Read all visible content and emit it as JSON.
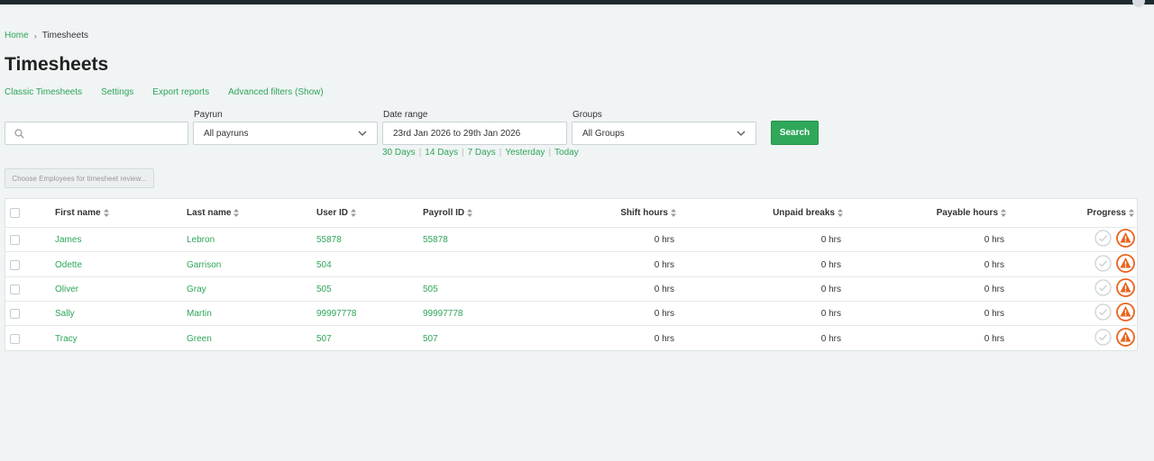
{
  "breadcrumb": {
    "home": "Home",
    "separator": "›",
    "current": "Timesheets"
  },
  "page_title": "Timesheets",
  "subnav": [
    "Classic Timesheets",
    "Settings",
    "Export reports",
    "Advanced filters (Show)"
  ],
  "search": {
    "value": "",
    "placeholder": ""
  },
  "filters": {
    "payrun": {
      "label": "Payrun",
      "value": "All payruns"
    },
    "date_range": {
      "label": "Date range",
      "value": "23rd Jan 2026 to 29th Jan 2026"
    },
    "groups": {
      "label": "Groups",
      "value": "All Groups"
    }
  },
  "quick_ranges": [
    "30 Days",
    "14 Days",
    "7 Days",
    "Yesterday",
    "Today"
  ],
  "quick_range_separator": "|",
  "search_button": "Search",
  "choose_button": "Choose Employees for timesheet review...",
  "table": {
    "headers": {
      "first_name": "First name",
      "last_name": "Last name",
      "user_id": "User ID",
      "payroll_id": "Payroll ID",
      "shift_hours": "Shift hours",
      "unpaid_breaks": "Unpaid breaks",
      "payable_hours": "Payable hours",
      "progress": "Progress"
    },
    "rows": [
      {
        "first_name": "James",
        "last_name": "Lebron",
        "user_id": "55878",
        "payroll_id": "55878",
        "shift_hours": "0 hrs",
        "unpaid_breaks": "0 hrs",
        "payable_hours": "0 hrs"
      },
      {
        "first_name": "Odette",
        "last_name": "Garrison",
        "user_id": "504",
        "payroll_id": "",
        "shift_hours": "0 hrs",
        "unpaid_breaks": "0 hrs",
        "payable_hours": "0 hrs"
      },
      {
        "first_name": "Oliver",
        "last_name": "Gray",
        "user_id": "505",
        "payroll_id": "505",
        "shift_hours": "0 hrs",
        "unpaid_breaks": "0 hrs",
        "payable_hours": "0 hrs"
      },
      {
        "first_name": "Sally",
        "last_name": "Martin",
        "user_id": "99997778",
        "payroll_id": "99997778",
        "shift_hours": "0 hrs",
        "unpaid_breaks": "0 hrs",
        "payable_hours": "0 hrs"
      },
      {
        "first_name": "Tracy",
        "last_name": "Green",
        "user_id": "507",
        "payroll_id": "507",
        "shift_hours": "0 hrs",
        "unpaid_breaks": "0 hrs",
        "payable_hours": "0 hrs"
      }
    ]
  },
  "colors": {
    "accent": "#2ea55a",
    "warning": "#e8631c",
    "background": "#f0f4f5"
  },
  "icons": {
    "search": "search-icon",
    "dropdown": "chevron-down-icon",
    "sort": "sort-icon",
    "approved": "check-circle-icon",
    "warning": "warning-triangle-icon"
  }
}
